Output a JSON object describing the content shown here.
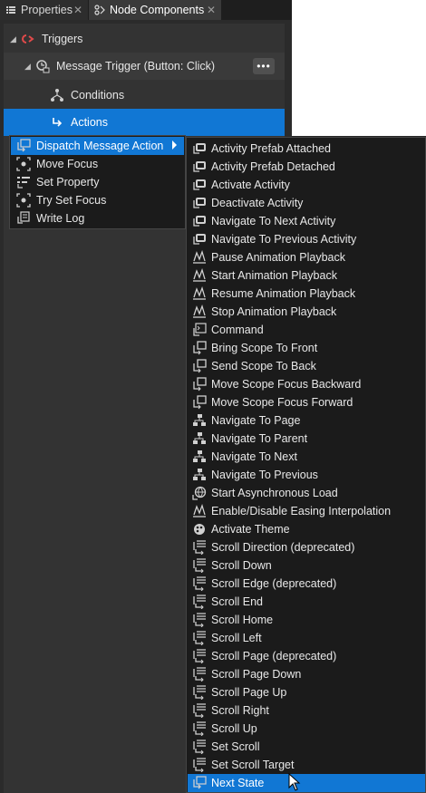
{
  "tabs": [
    {
      "label": "Properties",
      "icon": "list-icon"
    },
    {
      "label": "Node Components",
      "icon": "nodes-icon"
    }
  ],
  "tree": {
    "triggers": "Triggers",
    "message_trigger": "Message Trigger (Button: Click)",
    "more_label": "•••",
    "conditions": "Conditions",
    "actions": "Actions"
  },
  "action_menu": {
    "items": [
      {
        "label": "Dispatch Message Action",
        "icon": "dispatch-icon",
        "submenu": true,
        "active": true
      },
      {
        "label": "Move Focus",
        "icon": "focus-icon"
      },
      {
        "label": "Set Property",
        "icon": "property-icon"
      },
      {
        "label": "Try Set Focus",
        "icon": "focus-icon"
      },
      {
        "label": "Write Log",
        "icon": "log-icon"
      }
    ]
  },
  "dispatch_submenu": {
    "items": [
      {
        "label": "Activity Prefab Attached",
        "icon": "activity-icon"
      },
      {
        "label": "Activity Prefab Detached",
        "icon": "activity-icon"
      },
      {
        "label": "Activate Activity",
        "icon": "activity-icon"
      },
      {
        "label": "Deactivate Activity",
        "icon": "activity-icon"
      },
      {
        "label": "Navigate To Next Activity",
        "icon": "activity-icon"
      },
      {
        "label": "Navigate To Previous Activity",
        "icon": "activity-icon"
      },
      {
        "label": "Pause Animation Playback",
        "icon": "animation-icon"
      },
      {
        "label": "Start Animation Playback",
        "icon": "animation-icon"
      },
      {
        "label": "Resume Animation Playback",
        "icon": "animation-icon"
      },
      {
        "label": "Stop Animation Playback",
        "icon": "animation-icon"
      },
      {
        "label": "Command",
        "icon": "command-icon"
      },
      {
        "label": "Bring Scope To Front",
        "icon": "scope-icon"
      },
      {
        "label": "Send Scope To Back",
        "icon": "scope-icon"
      },
      {
        "label": "Move Scope Focus Backward",
        "icon": "scope-icon"
      },
      {
        "label": "Move Scope Focus Forward",
        "icon": "scope-icon"
      },
      {
        "label": "Navigate To Page",
        "icon": "navigation-icon"
      },
      {
        "label": "Navigate To Parent",
        "icon": "navigation-icon"
      },
      {
        "label": "Navigate To Next",
        "icon": "navigation-icon"
      },
      {
        "label": "Navigate To Previous",
        "icon": "navigation-icon"
      },
      {
        "label": "Start Asynchronous Load",
        "icon": "globe-icon"
      },
      {
        "label": "Enable/Disable Easing Interpolation",
        "icon": "animation-icon"
      },
      {
        "label": "Activate Theme",
        "icon": "theme-icon"
      },
      {
        "label": "Scroll Direction (deprecated)",
        "icon": "scroll-icon"
      },
      {
        "label": "Scroll Down",
        "icon": "scroll-icon"
      },
      {
        "label": "Scroll Edge (deprecated)",
        "icon": "scroll-icon"
      },
      {
        "label": "Scroll End",
        "icon": "scroll-icon"
      },
      {
        "label": "Scroll Home",
        "icon": "scroll-icon"
      },
      {
        "label": "Scroll Left",
        "icon": "scroll-icon"
      },
      {
        "label": "Scroll Page (deprecated)",
        "icon": "scroll-icon"
      },
      {
        "label": "Scroll Page Down",
        "icon": "scroll-icon"
      },
      {
        "label": "Scroll Page Up",
        "icon": "scroll-icon"
      },
      {
        "label": "Scroll Right",
        "icon": "scroll-icon"
      },
      {
        "label": "Scroll Up",
        "icon": "scroll-icon"
      },
      {
        "label": "Set Scroll",
        "icon": "scroll-icon"
      },
      {
        "label": "Set Scroll Target",
        "icon": "scroll-icon"
      },
      {
        "label": "Next State",
        "icon": "dispatch-icon",
        "selected": true
      }
    ]
  },
  "colors": {
    "accent": "#1177d4",
    "menu_bg": "#1b1b1b",
    "panel_bg": "#333333",
    "trigger_icon": "#e04a4a"
  }
}
